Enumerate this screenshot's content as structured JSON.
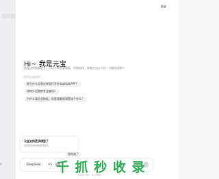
{
  "header": {
    "login_label": "登录"
  },
  "sidebar": {
    "marker": "0"
  },
  "welcome": {
    "title": "Hi~ 我是元宝",
    "intro": "你身边的智能助手，可以为你答疑解惑、尽情创作，快来点击以下任一功能体验吧~"
  },
  "suggestions": {
    "heading": "你可以这样问",
    "items": [
      "我为什么总是在夜里打开外卖或电商APP？",
      "如何介绍我的专注感吗？",
      "为什么我总会拖延，但是我都很清楚该干什么？"
    ]
  },
  "chat_bubble": {
    "title": "元宝支持更多模型了",
    "text": "在模型选择里体验更多能力",
    "button_label": "我知道了"
  },
  "composer": {
    "model_label": "DeepSeek",
    "mode_label": "R1 · 深度"
  },
  "footer": {
    "text": "内容由AI生成，请仔细甄别"
  },
  "watermark": {
    "text": "千 抓 秒 收 录"
  }
}
